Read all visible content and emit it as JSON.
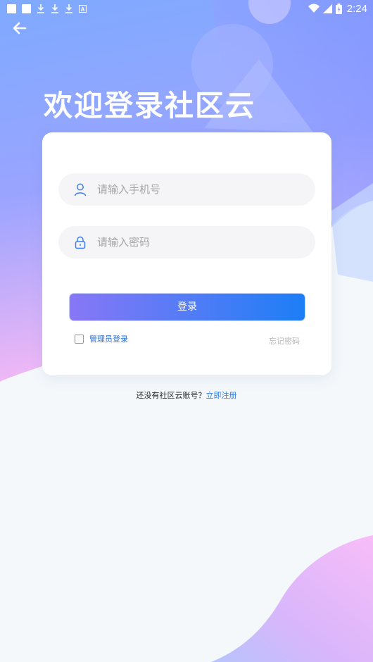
{
  "status_bar": {
    "time": "2:24",
    "left_icons": [
      "notification-square-icon",
      "notification-square-icon",
      "download-icon",
      "download-icon",
      "download-icon",
      "a-box-icon"
    ],
    "right_icons": [
      "wifi-icon",
      "cellular-signal-icon",
      "battery-charging-icon"
    ]
  },
  "header": {
    "back_icon": "arrow-left-icon",
    "title": "欢迎登录社区云"
  },
  "form": {
    "phone": {
      "icon": "user-icon",
      "placeholder": "请输入手机号",
      "value": ""
    },
    "password": {
      "icon": "lock-icon",
      "placeholder": "请输入密码",
      "value": ""
    },
    "login_label": "登录",
    "admin_login_label": "管理员登录",
    "admin_checked": false,
    "forgot_label": "忘记密码"
  },
  "footer": {
    "no_account_text": "还没有社区云账号？",
    "register_label": "立即注册"
  },
  "colors": {
    "primary_gradient_start": "#8877f6",
    "primary_gradient_end": "#1c7ef6",
    "link": "#2a7be0",
    "header_bg_start": "#7aa7ff",
    "header_bg_end": "#f4b8f3"
  }
}
